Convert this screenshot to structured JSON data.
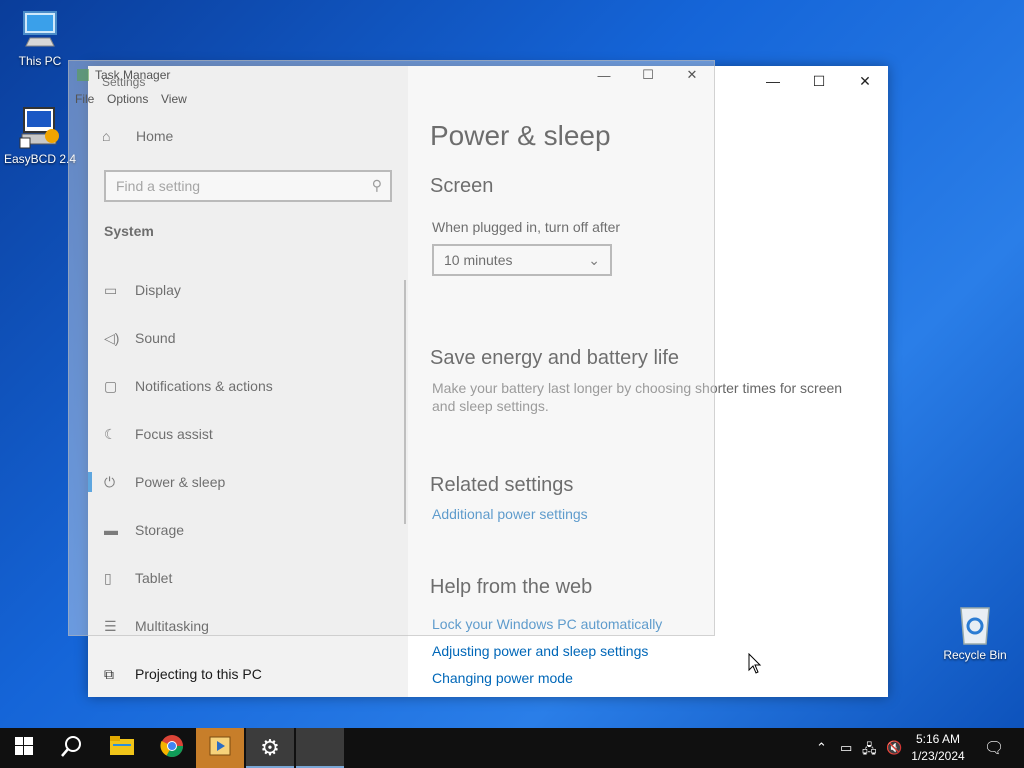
{
  "desktop": {
    "icons": [
      {
        "label": "This PC"
      },
      {
        "label": "EasyBCD 2.4"
      },
      {
        "label": "Recycle Bin"
      }
    ]
  },
  "settings": {
    "window_title": "Settings",
    "home_label": "Home",
    "search_placeholder": "Find a setting",
    "section_header": "System",
    "nav_items": [
      {
        "label": "Display",
        "icon": "monitor-icon"
      },
      {
        "label": "Sound",
        "icon": "speaker-icon"
      },
      {
        "label": "Notifications & actions",
        "icon": "notification-icon"
      },
      {
        "label": "Focus assist",
        "icon": "moon-icon"
      },
      {
        "label": "Power & sleep",
        "icon": "power-icon",
        "active": true
      },
      {
        "label": "Storage",
        "icon": "storage-icon"
      },
      {
        "label": "Tablet",
        "icon": "tablet-icon"
      },
      {
        "label": "Multitasking",
        "icon": "multitasking-icon"
      },
      {
        "label": "Projecting to this PC",
        "icon": "projector-icon"
      }
    ],
    "main": {
      "title": "Power & sleep",
      "screen_heading": "Screen",
      "screen_label": "When plugged in, turn off after",
      "screen_value": "10 minutes",
      "save_heading": "Save energy and battery life",
      "save_desc": "Make your battery last longer by choosing shorter times for screen and sleep settings.",
      "related_heading": "Related settings",
      "related_link": "Additional power settings",
      "help_heading": "Help from the web",
      "help_links": [
        "Lock your Windows PC automatically",
        "Adjusting power and sleep settings",
        "Changing power mode"
      ]
    }
  },
  "taskmanager": {
    "title": "Task Manager",
    "menu": [
      "File",
      "Options",
      "View"
    ]
  },
  "taskbar": {
    "time": "5:16 AM",
    "date": "1/23/2024",
    "accent": "#0078d7"
  }
}
